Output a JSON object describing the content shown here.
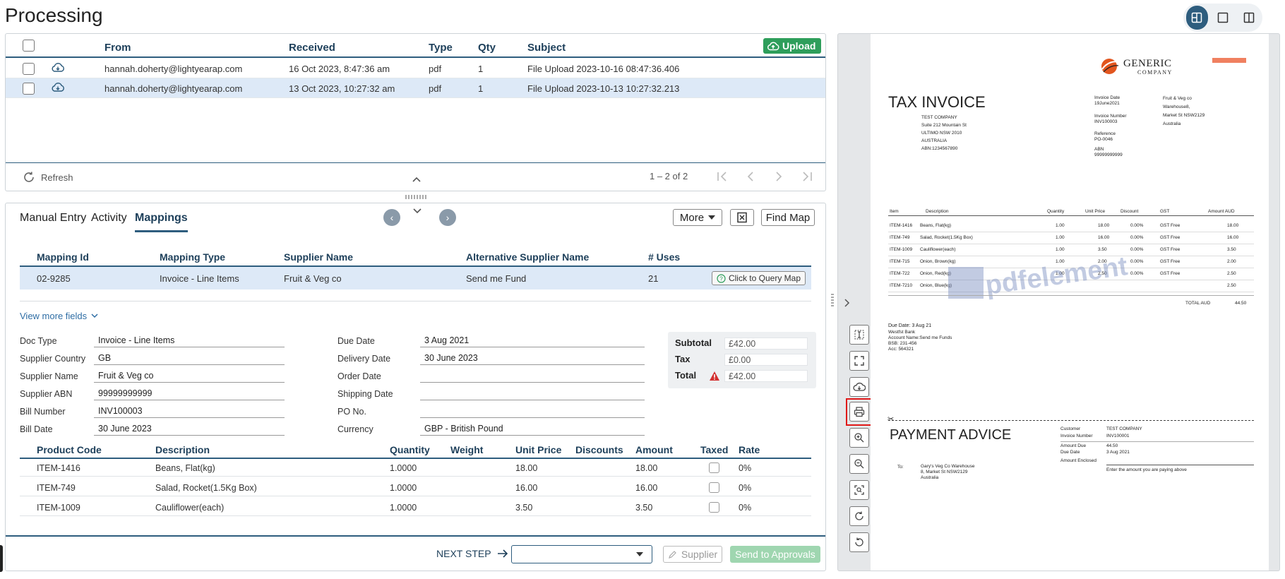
{
  "page_title": "Processing",
  "grid": {
    "headers": {
      "from": "From",
      "received": "Received",
      "type": "Type",
      "qty": "Qty",
      "subject": "Subject"
    },
    "upload_label": "Upload",
    "rows": [
      {
        "from": "hannah.doherty@lightyearap.com",
        "received": "16 Oct 2023, 8:47:36 am",
        "type": "pdf",
        "qty": "1",
        "subject": "File Upload 2023-10-16 08:47:36.406"
      },
      {
        "from": "hannah.doherty@lightyearap.com",
        "received": "13 Oct 2023, 10:27:32 am",
        "type": "pdf",
        "qty": "1",
        "subject": "File Upload 2023-10-13 10:27:32.213"
      }
    ],
    "refresh_label": "Refresh",
    "pagination": "1 – 2 of 2"
  },
  "tabs": {
    "manual_entry": "Manual Entry",
    "activity": "Activity",
    "mappings": "Mappings"
  },
  "toolbar": {
    "more_label": "More",
    "find_map_label": "Find Map"
  },
  "mapping": {
    "headers": {
      "id": "Mapping Id",
      "type": "Mapping Type",
      "supplier": "Supplier Name",
      "alt_supplier": "Alternative Supplier Name",
      "uses": "# Uses"
    },
    "row": {
      "id": "02-9285",
      "type": "Invoice - Line Items",
      "supplier": "Fruit & Veg co",
      "alt_supplier": "Send me Fund",
      "uses": "21",
      "query_label": "Click to Query Map"
    }
  },
  "view_more": "View more fields",
  "fields": {
    "doc_type": {
      "label": "Doc Type",
      "value": "Invoice - Line Items"
    },
    "supplier_country": {
      "label": "Supplier Country",
      "value": "GB"
    },
    "supplier_name": {
      "label": "Supplier Name",
      "value": "Fruit & Veg  co"
    },
    "supplier_abn": {
      "label": "Supplier ABN",
      "value": "99999999999"
    },
    "bill_number": {
      "label": "Bill Number",
      "value": "INV100003"
    },
    "bill_date": {
      "label": "Bill Date",
      "value": "30 June 2023"
    },
    "due_date": {
      "label": "Due Date",
      "value": "3 Aug 2021"
    },
    "delivery_date": {
      "label": "Delivery Date",
      "value": "30 June 2023"
    },
    "order_date": {
      "label": "Order Date",
      "value": ""
    },
    "shipping_date": {
      "label": "Shipping Date",
      "value": ""
    },
    "po_no": {
      "label": "PO No.",
      "value": ""
    },
    "currency": {
      "label": "Currency",
      "value": "GBP - British Pound"
    }
  },
  "totals": {
    "subtotal_label": "Subtotal",
    "subtotal": "£42.00",
    "tax_label": "Tax",
    "tax": "£0.00",
    "total_label": "Total",
    "total": "£42.00"
  },
  "lines": {
    "headers": {
      "code": "Product Code",
      "desc": "Description",
      "qty": "Quantity",
      "weight": "Weight",
      "price": "Unit Price",
      "disc": "Discounts",
      "amount": "Amount",
      "taxed": "Taxed",
      "rate": "Rate"
    },
    "rows": [
      {
        "code": "ITEM-1416",
        "desc": "Beans, Flat(kg)",
        "qty": "1.0000",
        "price": "18.00",
        "amount": "18.00",
        "rate": "0%"
      },
      {
        "code": "ITEM-749",
        "desc": "Salad, Rocket(1.5Kg Box)",
        "qty": "1.0000",
        "price": "16.00",
        "amount": "16.00",
        "rate": "0%"
      },
      {
        "code": "ITEM-1009",
        "desc": "Cauliflower(each)",
        "qty": "1.0000",
        "price": "3.50",
        "amount": "3.50",
        "rate": "0%"
      }
    ]
  },
  "footer": {
    "next_step": "NEXT STEP",
    "supplier_label": "Supplier",
    "send_label": "Send to Approvals"
  },
  "pdf": {
    "logo_line1": "Generic",
    "logo_line2": "Company",
    "tax_invoice": "TAX INVOICE",
    "from_lines": [
      "TEST COMPANY",
      "Suite 212 Mountain St",
      "ULTIMO NSW 2010",
      "AUSTRALIA",
      "ABN:1234567890"
    ],
    "meta_lines": [
      "Invoice Date",
      "19June2021",
      "Invoice Number",
      "INV100003",
      "Reference",
      "PO-0046",
      "ABN",
      "99999999999"
    ],
    "to_lines": [
      "Fruit & Veg co",
      "Warehouse8,",
      "Market St NSW2129",
      "Australia"
    ],
    "table_headers": [
      "Item",
      "Description",
      "Quantity",
      "Unit Price",
      "Discount",
      "GST",
      "Amount AUD"
    ],
    "table_rows": [
      [
        "ITEM-1416",
        "Beans, Flat(kg)",
        "1.00",
        "18.00",
        "0.00%",
        "GST Free",
        "18.00"
      ],
      [
        "ITEM-749",
        "Salad, Rocket(1.5Kg Box)",
        "1.00",
        "16.00",
        "0.00%",
        "GST Free",
        "16.00"
      ],
      [
        "ITEM-1009",
        "Cauliflower(each)",
        "1.00",
        "3.50",
        "0.00%",
        "GST Free",
        "3.50"
      ],
      [
        "ITEM-715",
        "Onion, Brown(kg)",
        "1.00",
        "2.00",
        "0.00%",
        "GST Free",
        "2.00"
      ],
      [
        "ITEM-722",
        "Onion, Red(kg)",
        "1.00",
        "2.50",
        "0.00%",
        "GST Free",
        "2.50"
      ],
      [
        "ITEM-7210",
        "Onion, Blue(kg)",
        "",
        "",
        "",
        "",
        "2.50"
      ]
    ],
    "total_label": "TOTAL AUD",
    "total_value": "44.50",
    "watermark": "pdfelement",
    "due_lines": [
      "Due Date: 3 Aug 21",
      "Westfst Bank",
      "Account Name:Send me Funds",
      "BSB: 231-456",
      "Acc: 564321"
    ],
    "payment_advice": "PAYMENT ADVICE",
    "pa_labels": [
      "Customer",
      "Invoice Number",
      "Amount Due",
      "Due Date",
      "Amount Enclosed"
    ],
    "pa_values": [
      "TEST COMPANY",
      "INV100001",
      "44.50",
      "3 Aug 2021",
      ""
    ],
    "pa_to_label": "To:",
    "pa_to_lines": [
      "Gary's Veg Co Warehouse",
      "8, Market St NSW2129",
      "Australia"
    ],
    "pa_hint": "Enter the amount you are paying above"
  }
}
